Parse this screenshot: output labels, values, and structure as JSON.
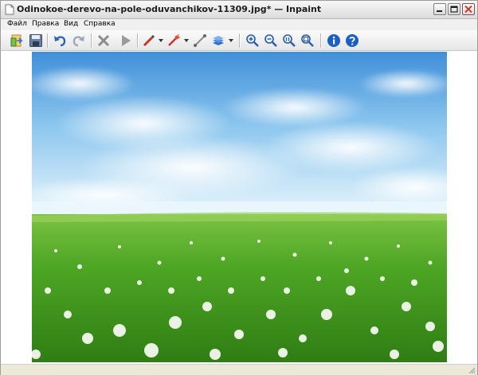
{
  "window": {
    "title": "Odinokoe-derevo-na-pole-oduvanchikov-11309.jpg* — Inpaint"
  },
  "menu": {
    "items": [
      {
        "label": "Файл"
      },
      {
        "label": "Правка"
      },
      {
        "label": "Вид"
      },
      {
        "label": "Справка"
      }
    ]
  },
  "toolbar": {
    "tools": [
      "open-icon",
      "save-icon",
      "undo-icon",
      "redo-icon",
      "erase-icon",
      "run-icon",
      "marker-icon",
      "magic-wand-icon",
      "line-icon",
      "layers-icon",
      "zoom-in-icon",
      "zoom-out-icon",
      "zoom-actual-icon",
      "zoom-fit-icon",
      "info-icon",
      "help-icon"
    ]
  },
  "canvas": {
    "image": "dandelion field under blue sky with clouds"
  },
  "colors": {
    "sky_top": "#3f8fd9",
    "sky_horizon": "#dff1fb",
    "grass": "#3f9a1f",
    "info_blue": "#1b5fc4",
    "close_red": "#c23a2a"
  }
}
